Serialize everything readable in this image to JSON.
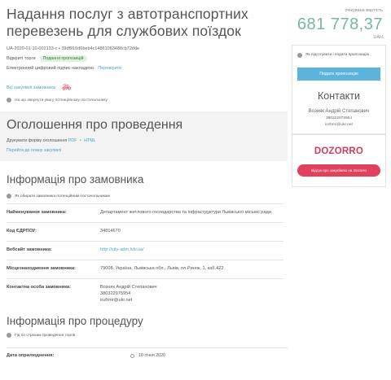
{
  "tender": {
    "title": "Надання послуг з автотранспортних перевезень для службових поїздок",
    "id": "UA-2020-01-10-002133-c • 39df916d6beb4c14861063488cb72dde",
    "type_label": "Відкриті торги",
    "status_badge": "Подання пропозицій",
    "signature_text": "Електронний цифровий підпис накладено.",
    "signature_link": "Перевірити",
    "all_purchases_link": "Всі закупівлі замовника",
    "attention_notice": "На що звернути увагу потенційному постачальнику"
  },
  "price": {
    "label": "очікувана вартість",
    "amount": "681 778,37",
    "currency": "UAH"
  },
  "side": {
    "notice": "Як підготувати і подати пропозицію",
    "submit_button": "Подати пропозицію",
    "contacts_title": "Контакти",
    "contact_name": "Возняк Андрій Степанович",
    "contact_phone": "380322975954",
    "contact_email": "inzhmr@ukr.net",
    "dozorro_logo": "DOZORRO",
    "review_button": "Відгук про закупівлю на Dozorro"
  },
  "announcement": {
    "title": "Оголошення про проведення",
    "print_label": "Друкувати форму оголошення",
    "pdf_link": "PDF",
    "dot": "•",
    "html_link": "HTML",
    "goto_link": "Перейти до плану закупівлі"
  },
  "customer": {
    "title": "Інформація про замовника",
    "notice": "Як обирати замовника потенційним постачальникам",
    "rows": [
      {
        "key": "Найменування замовника:",
        "value": "Департамент житлового господарства та інфраструктури Львівської міської ради"
      },
      {
        "key": "Код ЄДРПОУ:",
        "value": "34814670"
      },
      {
        "key": "Вебсайт замовника:",
        "value": "http://city-adm.lviv.ua/"
      },
      {
        "key": "Місцезнаходження замовника:",
        "value": "79008, Україна, Львівська обл., Львів, пл.Ринок, 1, каб.422"
      },
      {
        "key": "Контактна особа замовника:",
        "value": "Возняк Андрій Степанович",
        "value2": "380322975954",
        "value3": "inzhmr@ukr.net"
      }
    ]
  },
  "procedure": {
    "title": "Інформація про процедуру",
    "notice": "Гід по строкам проведення торгів",
    "date_key": "Дата оприлюднення:",
    "date_value": "10 січня 2020"
  }
}
